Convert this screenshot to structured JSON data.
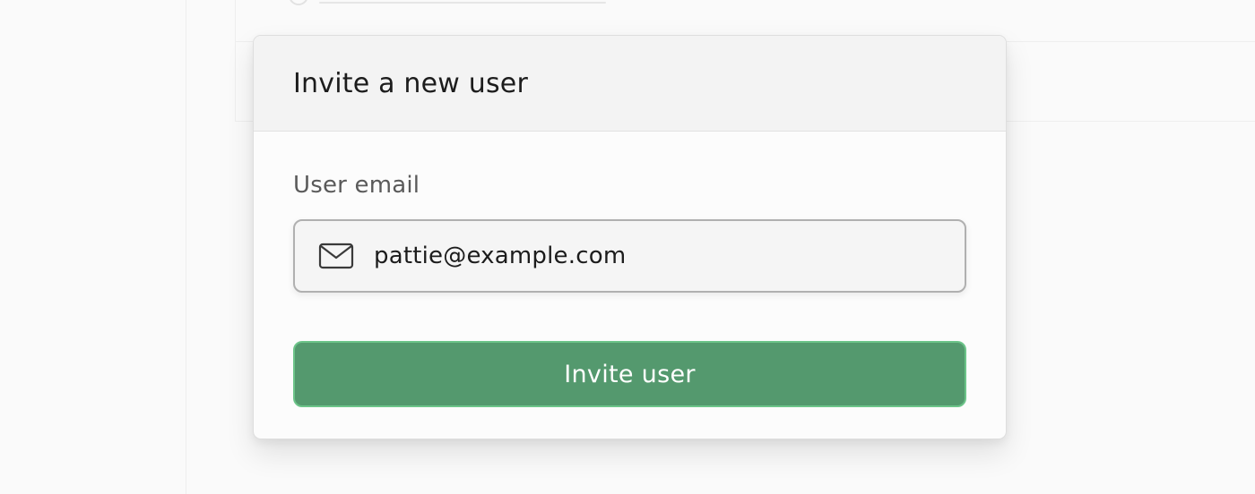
{
  "dialog": {
    "title": "Invite a new user",
    "email_label": "User email",
    "email_value": "pattie@example.com",
    "email_icon": "mail-icon",
    "submit_label": "Invite user"
  },
  "colors": {
    "primary_button": "#54996e",
    "primary_button_border": "#6cc489",
    "header_bg": "#f3f3f3",
    "page_bg": "#fafafa"
  }
}
